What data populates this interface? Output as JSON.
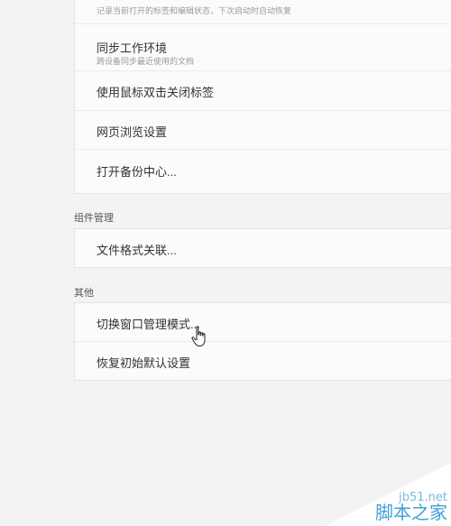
{
  "top_card": {
    "rows": [
      {
        "sub": "记录当前打开的标签和编辑状态，下次启动时自动恢复"
      },
      {
        "title": "同步工作环境",
        "sub": "跨设备同步最近使用的文档"
      },
      {
        "title": "使用鼠标双击关闭标签"
      },
      {
        "title": "网页浏览设置"
      },
      {
        "title": "打开备份中心..."
      }
    ]
  },
  "component_section": {
    "label": "组件管理",
    "rows": [
      {
        "title": "文件格式关联..."
      }
    ]
  },
  "other_section": {
    "label": "其他",
    "rows": [
      {
        "title": "切换窗口管理模式..."
      },
      {
        "title": "恢复初始默认设置"
      }
    ]
  },
  "watermark": {
    "site": "jb51.net",
    "name": "脚本之家"
  },
  "colors": {
    "page_bg": "#f3f3f3",
    "card_bg": "#fbfbfb",
    "border": "#e3e3e3",
    "watermark_blue": "#3ea0d8"
  }
}
